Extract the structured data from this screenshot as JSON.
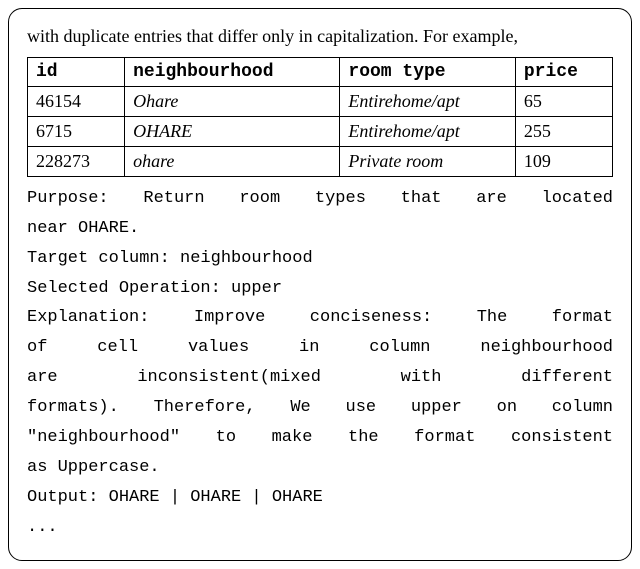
{
  "intro": "with duplicate entries that differ only in capitalization. For example,",
  "table": {
    "headers": [
      "id",
      "neighbourhood",
      "room type",
      "price"
    ],
    "rows": [
      {
        "id": "46154",
        "neighbourhood": "Ohare",
        "room_type": "Entirehome/apt",
        "price": "65"
      },
      {
        "id": "6715",
        "neighbourhood": "OHARE",
        "room_type": "Entirehome/apt",
        "price": "255"
      },
      {
        "id": "228273",
        "neighbourhood": "ohare",
        "room_type": "Private room",
        "price": "109"
      }
    ]
  },
  "purpose_l1": "Purpose: Return room types that are located",
  "purpose_l2": "near OHARE.",
  "target": "Target column: neighbourhood",
  "operation": "Selected Operation: upper",
  "exp_l1": "Explanation: Improve conciseness: The format",
  "exp_l2": "of cell values in column neighbourhood",
  "exp_l3": "are inconsistent(mixed with different",
  "exp_l4": "formats). Therefore, We use upper on column",
  "exp_l5": "\"neighbourhood\" to make the format consistent",
  "exp_l6": "as Uppercase.",
  "output": "Output: OHARE | OHARE | OHARE",
  "ellipsis": "..."
}
